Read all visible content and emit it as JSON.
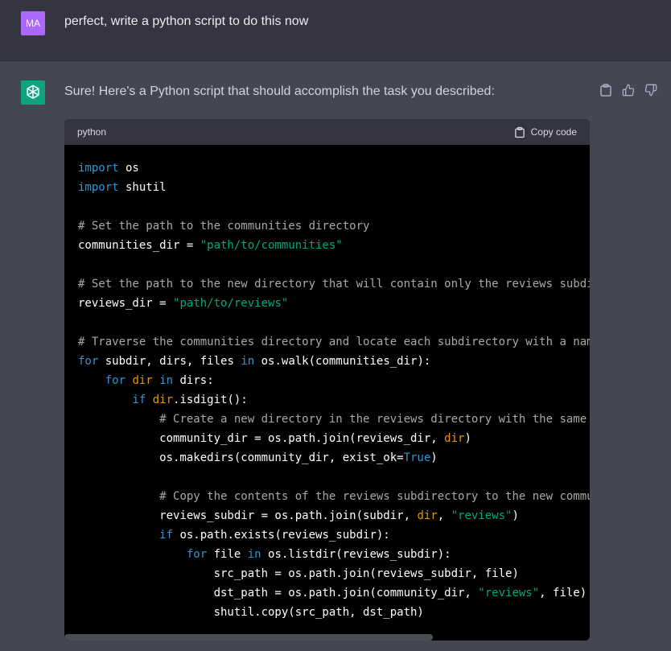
{
  "user_message": {
    "avatar_initials": "MA",
    "text": "perfect, write a python script to do this now"
  },
  "assistant_message": {
    "text": "Sure! Here's a Python script that should accomplish the task you described:"
  },
  "actions": {
    "icons": [
      "clipboard-icon",
      "thumbs-up-icon",
      "thumbs-down-icon"
    ]
  },
  "code_block": {
    "language": "python",
    "copy_label": "Copy code"
  },
  "colors": {
    "user_bg": "#343541",
    "assistant_bg": "#444654",
    "code_bg": "#000000",
    "keyword": "#2e95d3",
    "string": "#00a67d",
    "comment": "#a9a9a9",
    "builtin_var": "#e9950c",
    "gpt_brand": "#10a37f",
    "user_avatar": "#ab68ff"
  }
}
